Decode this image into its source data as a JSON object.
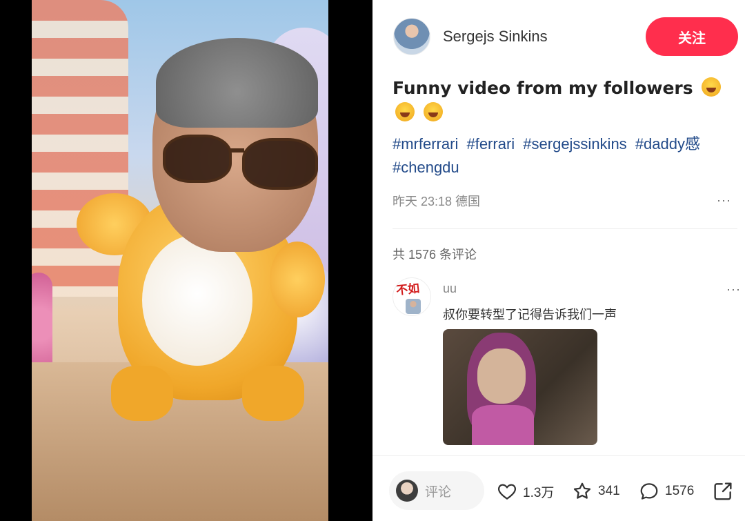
{
  "author": {
    "name": "Sergejs Sinkins",
    "follow_label": "关注"
  },
  "post": {
    "title": "Funny video from my followers",
    "title_emojis": [
      "face-with-tears-of-joy",
      "face-with-tears-of-joy",
      "face-with-tears-of-joy"
    ],
    "tags": [
      "#mrferrari",
      "#ferrari",
      "#sergejssinkins",
      "#daddy感",
      "#chengdu"
    ],
    "meta": "昨天 23:18 德国",
    "more": "···"
  },
  "comments": {
    "count_label": "共 1576 条评论",
    "items": [
      {
        "user": "uu",
        "avatar_logo_text": "不如",
        "text": "叔你要转型了记得告诉我们一声",
        "more": "···"
      }
    ]
  },
  "bottom_bar": {
    "input_placeholder": "评论",
    "likes": "1.3万",
    "collects": "341",
    "comments": "1576"
  },
  "colors": {
    "follow_button": "#ff2e4d",
    "tag_link": "#234b8a"
  }
}
